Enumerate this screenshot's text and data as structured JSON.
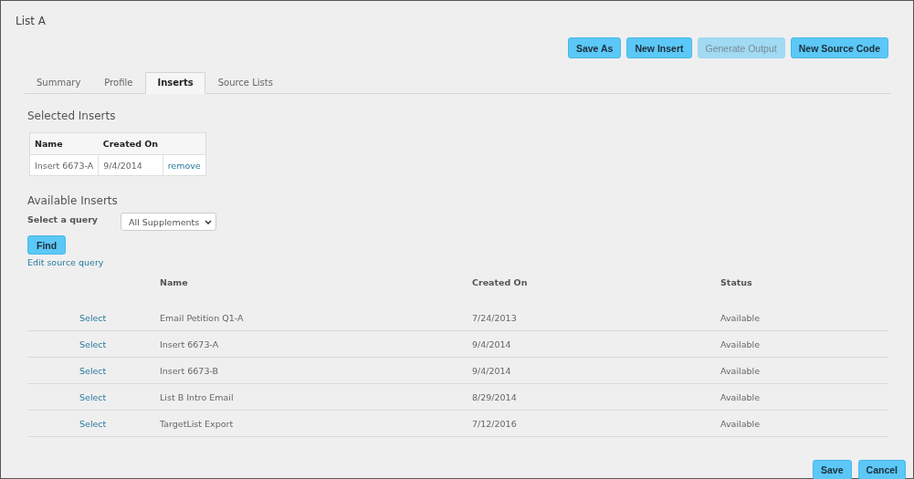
{
  "page": {
    "title": "List A"
  },
  "toolbar": [
    {
      "label": "Save As",
      "disabled": false
    },
    {
      "label": "New Insert",
      "disabled": false
    },
    {
      "label": "Generate Output",
      "disabled": true
    },
    {
      "label": "New Source Code",
      "disabled": false
    }
  ],
  "tabs": [
    {
      "label": "Summary",
      "selected": false
    },
    {
      "label": "Profile",
      "selected": false
    },
    {
      "label": "Inserts",
      "selected": true
    },
    {
      "label": "Source Lists",
      "selected": false
    }
  ],
  "selected_inserts": {
    "heading": "Selected Inserts",
    "columns": [
      "Name",
      "Created On"
    ],
    "rows": [
      {
        "name": "Insert 6673-A",
        "created_on": "9/4/2014",
        "action": "remove"
      }
    ]
  },
  "available_inserts": {
    "heading": "Available Inserts",
    "query_label": "Select a query",
    "query_value": "All Supplements",
    "find_button": "Find",
    "edit_link": "Edit source query",
    "columns": [
      "Name",
      "Created On",
      "Status"
    ],
    "rows": [
      {
        "action": "Select",
        "name": "Email Petition Q1-A",
        "created_on": "7/24/2013",
        "status": "Available"
      },
      {
        "action": "Select",
        "name": "Insert 6673-A",
        "created_on": "9/4/2014",
        "status": "Available"
      },
      {
        "action": "Select",
        "name": "Insert 6673-B",
        "created_on": "9/4/2014",
        "status": "Available"
      },
      {
        "action": "Select",
        "name": "List B Intro Email",
        "created_on": "8/29/2014",
        "status": "Available"
      },
      {
        "action": "Select",
        "name": "TargetList Export",
        "created_on": "7/12/2016",
        "status": "Available"
      }
    ]
  },
  "footer_buttons": [
    "Save",
    "Cancel"
  ]
}
